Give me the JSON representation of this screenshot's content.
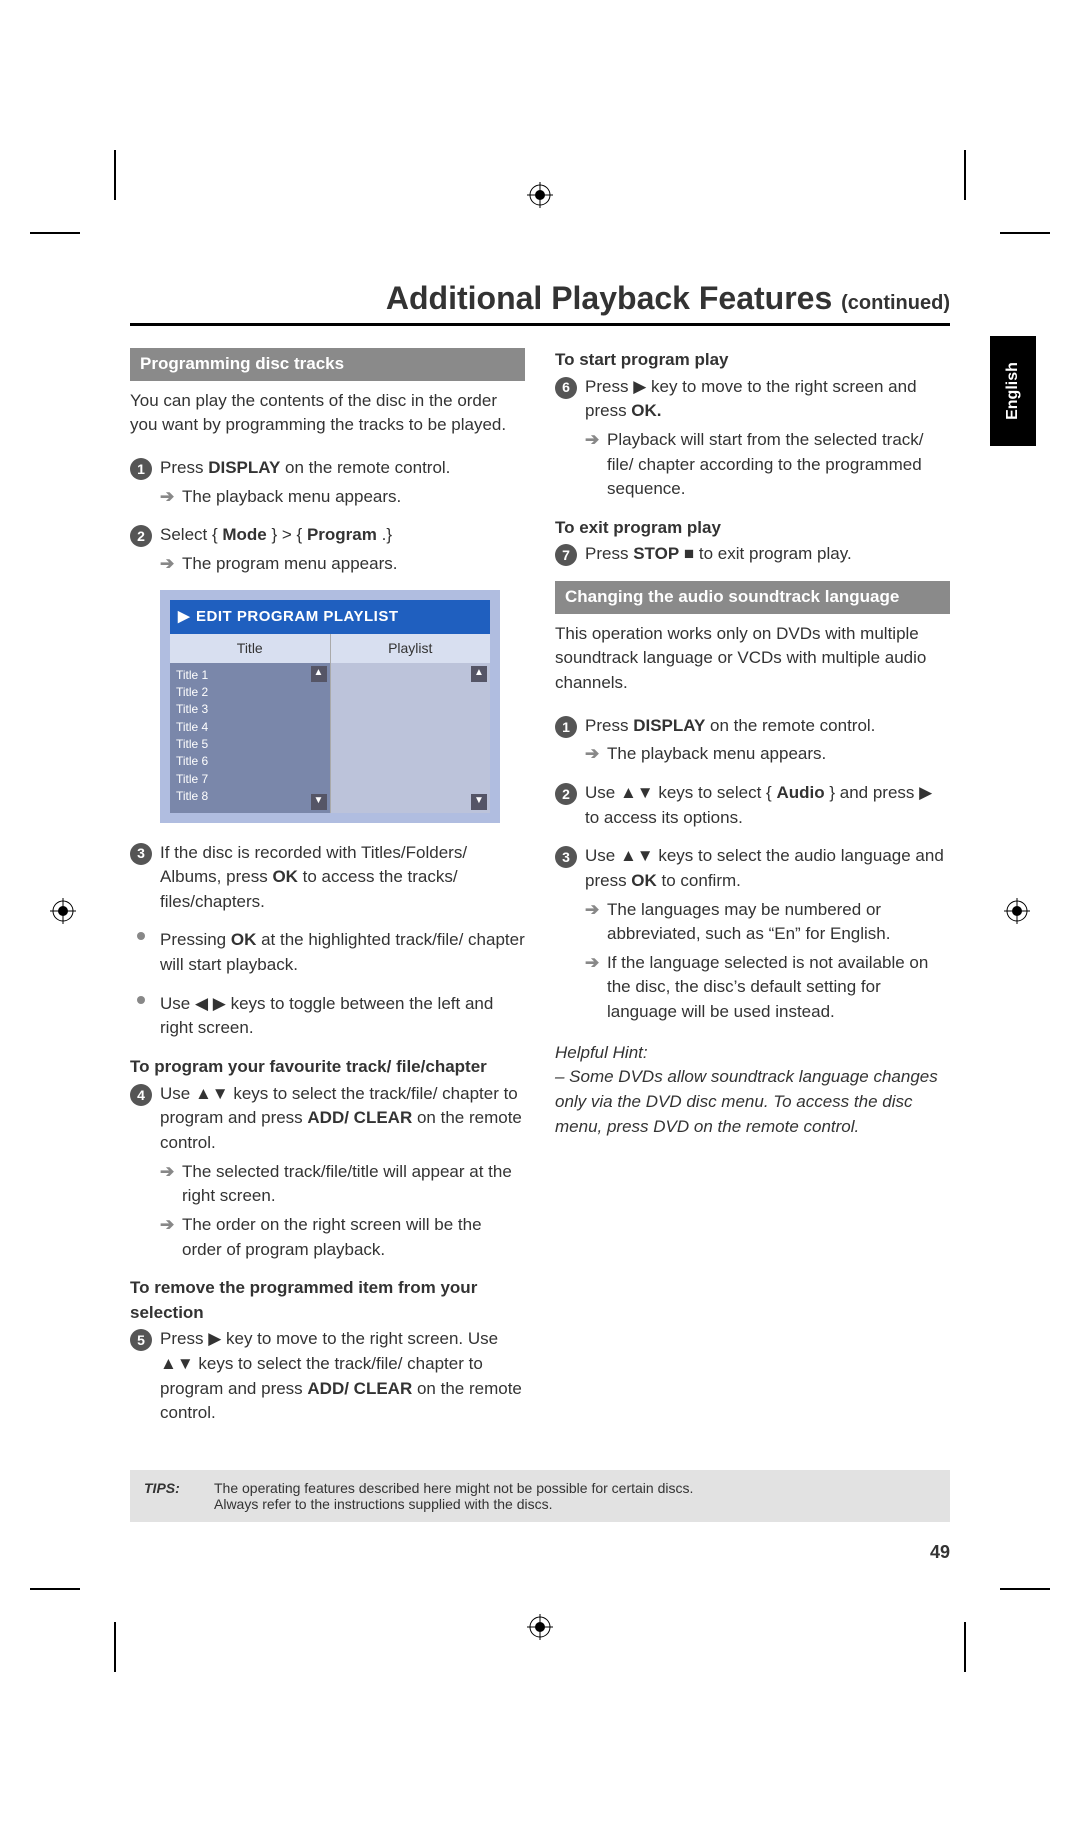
{
  "heading": {
    "main": "Additional Playback Features ",
    "cont": "(continued)"
  },
  "lang_tab": "English",
  "page_number": "49",
  "left": {
    "bar1": "Programming disc tracks",
    "intro": "You can play the contents of the disc in the order you want by programming the tracks to be played.",
    "s1_a": "Press ",
    "s1_b": "DISPLAY",
    "s1_c": "  on the remote control.",
    "s1_sub": "The playback menu appears.",
    "s2_a": "Select { ",
    "s2_b": "Mode",
    "s2_c": " } > { ",
    "s2_d": "Program",
    "s2_e": " .}",
    "s2_sub": "The program menu appears.",
    "s3": "If the disc is recorded with Titles/Folders/ Albums, press OK to access the tracks/ files/chapters.",
    "b1_a": "Pressing ",
    "b1_b": "OK",
    "b1_c": " at the highlighted track/file/ chapter will start playback.",
    "b2_a": "Use ",
    "b2_b": " keys to toggle between the left and right screen.",
    "sub4": "To program your favourite track/ file/chapter",
    "s4_a": "Use ",
    "s4_b": " keys to select the track/file/ chapter to program and press ",
    "s4_c": "ADD/ CLEAR",
    "s4_d": " on the remote control.",
    "s4_sub1": "The selected track/file/title will appear at the right screen.",
    "s4_sub2": "The order on the right screen will be the order of program playback.",
    "sub5": "To remove the programmed item from your selection",
    "s5_a": "Press ",
    "s5_b": " key to move to the right screen. Use ",
    "s5_c": " keys to select the track/file/ chapter to program and press ",
    "s5_d": "ADD/ CLEAR",
    "s5_e": " on the remote control."
  },
  "ui": {
    "title": "EDIT PROGRAM PLAYLIST",
    "col1": "Title",
    "col2": "Playlist",
    "rows": [
      "Title 1",
      "Title 2",
      "Title 3",
      "Title 4",
      "Title 5",
      "Title 6",
      "Title 7",
      "Title 8"
    ]
  },
  "right": {
    "sub6": "To start program play",
    "s6_a": "Press ",
    "s6_b": " key to move to the right screen and press ",
    "s6_c": "OK.",
    "s6_sub": "Playback will start from the selected track/ file/ chapter according to the programmed sequence.",
    "sub7": "To exit program play",
    "s7_a": "Press ",
    "s7_b": "STOP",
    "s7_c": " ",
    "s7_d": " to exit program play.",
    "bar2": "Changing the audio soundtrack language",
    "intro2": "This operation works only on DVDs with multiple soundtrack language or VCDs with multiple audio channels.",
    "r1_a": "Press ",
    "r1_b": "DISPLAY",
    "r1_c": "  on the remote control.",
    "r1_sub": "The playback menu appears.",
    "r2_a": "Use ",
    "r2_b": " keys to select { ",
    "r2_c": "Audio",
    "r2_d": " } and press ",
    "r2_e": " to access its options.",
    "r3_a": "Use ",
    "r3_b": " keys to select the audio language and press ",
    "r3_c": "OK",
    "r3_d": " to confirm.",
    "r3_sub1": "The languages may be numbered or abbreviated, such as “En” for English.",
    "r3_sub2": "If the language selected is not available on the disc, the disc’s default setting for language will be used instead.",
    "hint_head": "Helpful Hint:",
    "hint_body": "– Some DVDs allow soundtrack language changes only via the DVD disc menu. To access the disc menu, press DVD on the remote control."
  },
  "tips": {
    "label": "TIPS:",
    "line1": "The operating features described here might not be possible for certain discs.",
    "line2": "Always refer to the instructions supplied with the discs."
  }
}
